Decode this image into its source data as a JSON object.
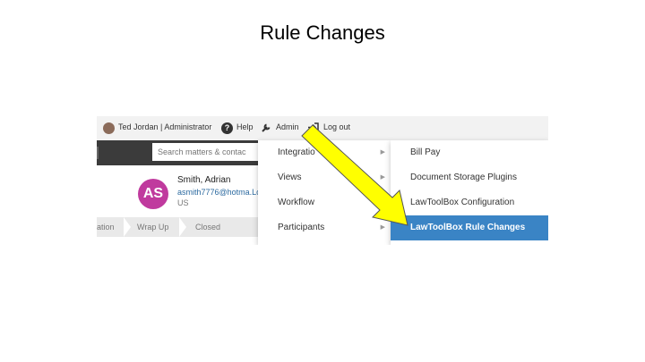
{
  "slide": {
    "title": "Rule Changes"
  },
  "topbar": {
    "user": "Ted Jordan | Administrator",
    "help": "Help",
    "admin": "Admin",
    "logout": "Log out"
  },
  "search": {
    "placeholder": "Search matters & contac"
  },
  "contact": {
    "initials": "AS",
    "name": "Smith, Adrian",
    "email": "asmith7776@hotma.Lo",
    "country": "US"
  },
  "stages": [
    "ation",
    "Wrap Up",
    "Closed"
  ],
  "admin_menu": {
    "items": [
      {
        "label": "Integratio",
        "has_submenu": true
      },
      {
        "label": "Views",
        "has_submenu": true
      },
      {
        "label": "Workflow",
        "has_submenu": false
      },
      {
        "label": "Participants",
        "has_submenu": true
      }
    ]
  },
  "integrations_submenu": {
    "items": [
      {
        "label": "Bill Pay"
      },
      {
        "label": "Document Storage Plugins"
      },
      {
        "label": "LawToolBox Configuration"
      },
      {
        "label": "LawToolBox Rule Changes",
        "selected": true
      }
    ]
  },
  "colors": {
    "accent": "#3a84c5",
    "avatar": "#c03a9e",
    "search_bar": "#3b3b3b",
    "arrow_fill": "#ffff00"
  },
  "icons": {
    "help": "question-circle-icon",
    "admin": "wrench-icon",
    "logout": "logout-icon",
    "submenu": "caret-right-icon"
  }
}
